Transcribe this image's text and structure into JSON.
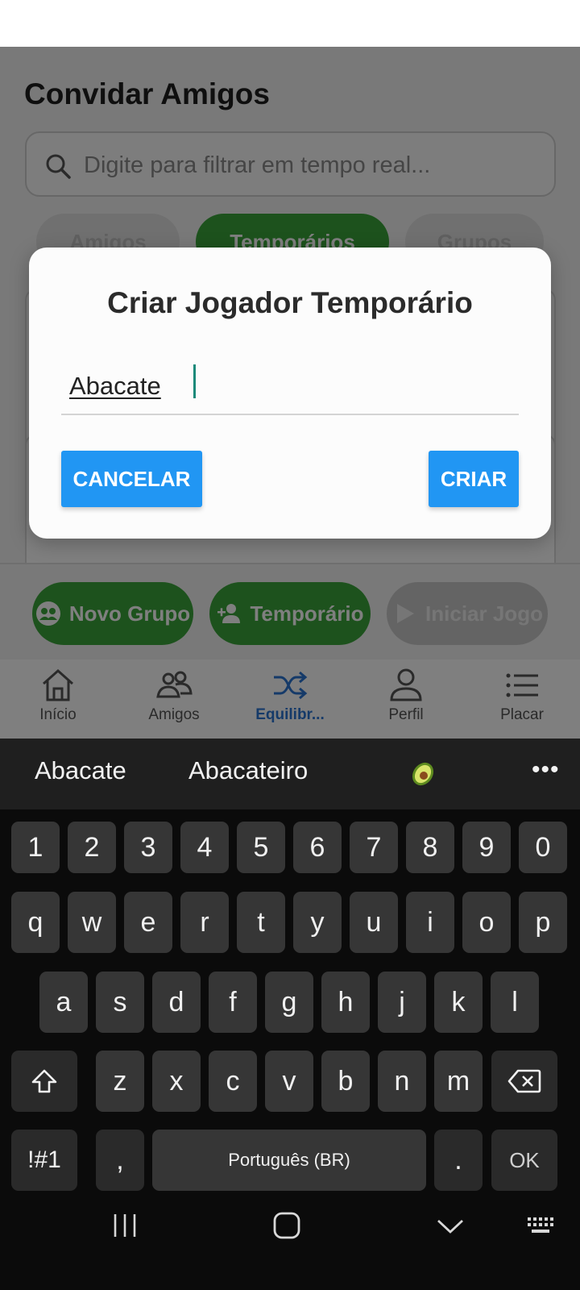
{
  "app": {
    "page_title": "Convidar Amigos",
    "search_placeholder": "Digite para filtrar em tempo real...",
    "tabs": [
      {
        "label": "Amigos"
      },
      {
        "label": "Temporários"
      },
      {
        "label": "Grupos"
      }
    ],
    "actions": [
      {
        "label": "Novo Grupo",
        "icon": "group-icon"
      },
      {
        "label": "Temporário",
        "icon": "add-person-icon"
      },
      {
        "label": "Iniciar Jogo",
        "icon": "play-icon"
      }
    ],
    "nav": [
      {
        "label": "Início",
        "icon": "home-icon"
      },
      {
        "label": "Amigos",
        "icon": "friends-icon"
      },
      {
        "label": "Equilibr...",
        "icon": "shuffle-icon",
        "active": true
      },
      {
        "label": "Perfil",
        "icon": "person-icon"
      },
      {
        "label": "Placar",
        "icon": "list-icon"
      }
    ]
  },
  "dialog": {
    "title": "Criar Jogador Temporário",
    "input_value": "Abacate",
    "cancel_label": "CANCELAR",
    "create_label": "CRIAR"
  },
  "keyboard": {
    "suggestions": [
      "Abacate",
      "Abacateiro"
    ],
    "suggestion_emoji": "avocado-emoji",
    "more_label": "•••",
    "row_numbers": [
      "1",
      "2",
      "3",
      "4",
      "5",
      "6",
      "7",
      "8",
      "9",
      "0"
    ],
    "row_1": [
      "q",
      "w",
      "e",
      "r",
      "t",
      "y",
      "u",
      "i",
      "o",
      "p"
    ],
    "row_2": [
      "a",
      "s",
      "d",
      "f",
      "g",
      "h",
      "j",
      "k",
      "l"
    ],
    "row_3": [
      "z",
      "x",
      "c",
      "v",
      "b",
      "n",
      "m"
    ],
    "symbols_label": "!#1",
    "comma_label": ",",
    "space_label": "Português (BR)",
    "period_label": ".",
    "ok_label": "OK"
  },
  "colors": {
    "accent_green": "#3aa43a",
    "dialog_button_blue": "#2196f3",
    "active_nav_blue": "#2a74d2",
    "keyboard_bg": "#0b0b0b",
    "key_bg": "#363636"
  }
}
